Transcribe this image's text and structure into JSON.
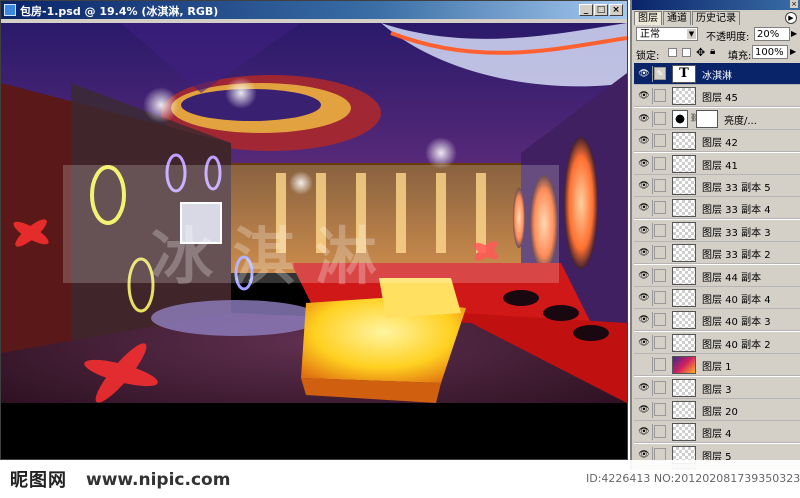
{
  "window": {
    "title": "包房-1.psd @ 19.4% (冰淇淋, RGB)",
    "buttons": [
      "_",
      "□",
      "×"
    ],
    "ruler_marker": "01"
  },
  "canvas": {
    "watermark_text": "冰淇淋"
  },
  "panel": {
    "tabs": [
      "图层",
      "通道",
      "历史记录"
    ],
    "blend_mode": "正常",
    "opacity_label": "不透明度:",
    "opacity_value": "20%",
    "lock_label": "锁定:",
    "fill_label": "填充:",
    "fill_value": "100%",
    "layers": [
      {
        "name": "冰淇淋",
        "type": "text",
        "visible": true,
        "selected": true
      },
      {
        "name": "图层 45",
        "type": "pixel",
        "visible": true
      },
      {
        "name": "亮度/...",
        "type": "adjustment",
        "visible": true
      },
      {
        "name": "图层 42",
        "type": "pixel",
        "visible": true
      },
      {
        "name": "图层 41",
        "type": "pixel",
        "visible": true
      },
      {
        "name": "图层 33 副本 5",
        "type": "pixel",
        "visible": true
      },
      {
        "name": "图层 33 副本 4",
        "type": "pixel",
        "visible": true
      },
      {
        "name": "图层 33 副本 3",
        "type": "pixel",
        "visible": true
      },
      {
        "name": "图层 33 副本 2",
        "type": "pixel",
        "visible": true
      },
      {
        "name": "图层 44 副本",
        "type": "pixel",
        "visible": true
      },
      {
        "name": "图层 40 副本 4",
        "type": "pixel",
        "visible": true
      },
      {
        "name": "图层 40 副本 3",
        "type": "pixel",
        "visible": true
      },
      {
        "name": "图层 40 副本 2",
        "type": "pixel",
        "visible": true
      },
      {
        "name": "图层 1",
        "type": "image",
        "visible": false
      },
      {
        "name": "图层 3",
        "type": "pixel",
        "visible": true
      },
      {
        "name": "图层 20",
        "type": "pixel",
        "visible": true
      },
      {
        "name": "图层 4",
        "type": "pixel",
        "visible": true
      },
      {
        "name": "图层 5",
        "type": "pixel",
        "visible": true
      },
      {
        "name": "",
        "type": "pixel",
        "visible": true
      }
    ]
  },
  "footer": {
    "logo": "昵图网",
    "url": "www.nipic.com",
    "id_text": "ID:4226413 NO:20120208173935032391"
  }
}
